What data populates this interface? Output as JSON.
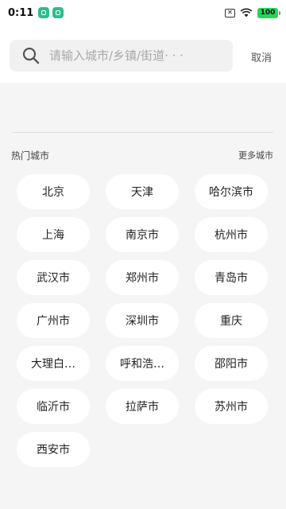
{
  "status_bar": {
    "time": "0:11",
    "battery": "100"
  },
  "search": {
    "placeholder": "请输入城市/乡镇/街道· · ·",
    "cancel_label": "取消"
  },
  "hot_cities": {
    "title": "热门城市",
    "more_label": "更多城市",
    "cities": [
      "北京",
      "天津",
      "哈尔滨市",
      "上海",
      "南京市",
      "杭州市",
      "武汉市",
      "郑州市",
      "青岛市",
      "广州市",
      "深圳市",
      "重庆",
      "大理白…",
      "呼和浩…",
      "邵阳市",
      "临沂市",
      "拉萨市",
      "苏州市",
      "西安市"
    ]
  }
}
